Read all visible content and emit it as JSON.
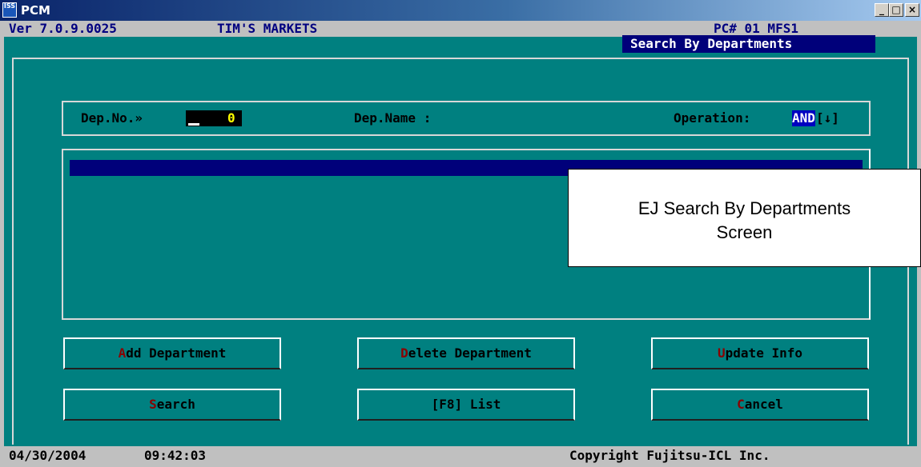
{
  "window": {
    "title": "PCM",
    "icon_label": "ISS",
    "controls": {
      "minimize": "_",
      "maximize": "□",
      "close": "×"
    }
  },
  "header": {
    "version": "Ver 7.0.9.0025",
    "store": "TIM'S MARKETS",
    "pc": "PC# 01 MFS1",
    "screen_title": "Search By Departments"
  },
  "search": {
    "dep_no_label": "Dep.No.»",
    "dep_no_value": "0",
    "dep_name_label": "Dep.Name :",
    "operation_label": "Operation:",
    "operation_value": "AND",
    "operation_arrow": "[↓]"
  },
  "buttons": {
    "add": {
      "hot": "A",
      "rest": "dd Department"
    },
    "delete": {
      "hot": "D",
      "rest": "elete Department"
    },
    "update": {
      "hot": "U",
      "rest": "pdate Info"
    },
    "search": {
      "hot": "S",
      "rest": "earch"
    },
    "list": {
      "hot": "",
      "rest": "[F8] List"
    },
    "cancel": {
      "hot": "C",
      "rest": "ancel"
    }
  },
  "status": {
    "date": "04/30/2004",
    "time": "09:42:03",
    "copyright": "Copyright Fujitsu-ICL Inc."
  },
  "caption": {
    "line1": "EJ Search By Departments",
    "line2": "Screen"
  },
  "colors": {
    "background": "#008080",
    "highlight_bar": "#00007a",
    "hotkey": "#8b0000",
    "field_value": "#ffff00"
  }
}
